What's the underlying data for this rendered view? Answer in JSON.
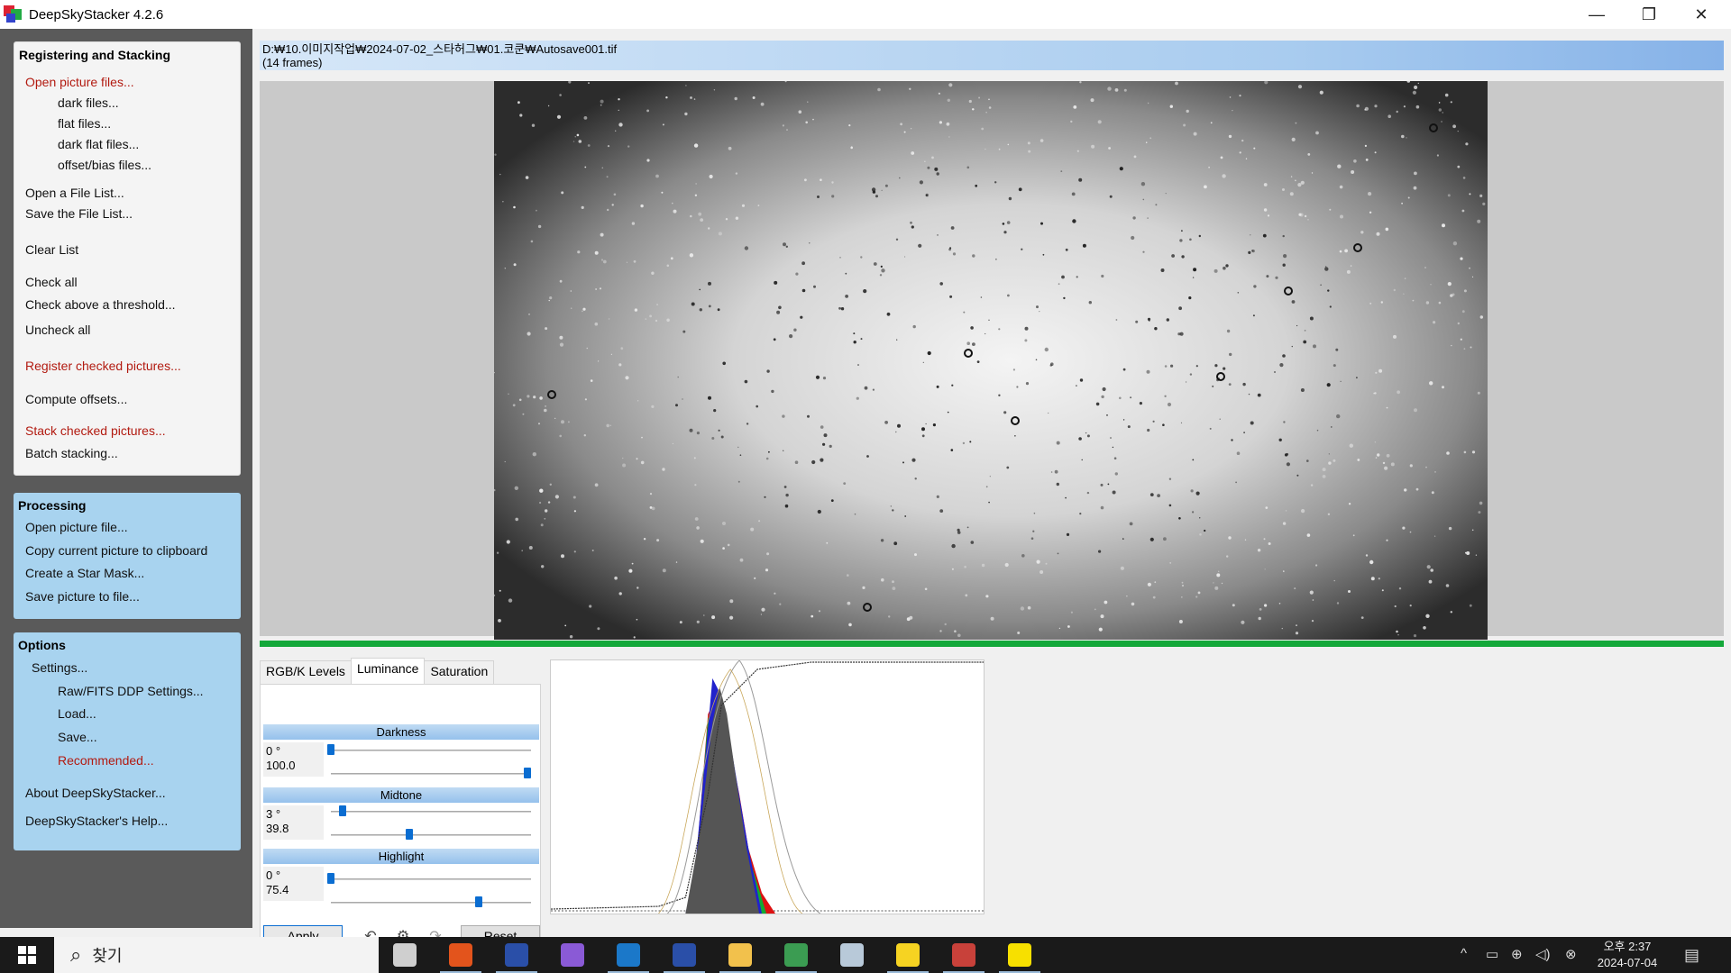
{
  "window": {
    "title": "DeepSkyStacker 4.2.6",
    "minimize_icon": "—",
    "restore_icon": "❐",
    "close_icon": "✕"
  },
  "groups": {
    "registering": {
      "title": "Registering and Stacking",
      "items": [
        {
          "label": "Open picture files...",
          "style": "red"
        },
        {
          "label": "dark files...",
          "style": "dark"
        },
        {
          "label": "flat files...",
          "style": "dark"
        },
        {
          "label": "dark flat files...",
          "style": "dark"
        },
        {
          "label": "offset/bias files...",
          "style": "dark"
        },
        {
          "label": "Open a File List...",
          "style": "dark"
        },
        {
          "label": "Save the File List...",
          "style": "dark"
        },
        {
          "label": "Clear List",
          "style": "dark"
        },
        {
          "label": "Check all",
          "style": "dark"
        },
        {
          "label": "Check above a threshold...",
          "style": "dark"
        },
        {
          "label": "Uncheck all",
          "style": "dark"
        },
        {
          "label": "Register checked pictures...",
          "style": "red"
        },
        {
          "label": "Compute offsets...",
          "style": "dark"
        },
        {
          "label": "Stack checked pictures...",
          "style": "red"
        },
        {
          "label": "Batch stacking...",
          "style": "dark"
        }
      ]
    },
    "processing": {
      "title": "Processing",
      "items": [
        {
          "label": "Open picture file..."
        },
        {
          "label": "Copy current picture to clipboard"
        },
        {
          "label": "Create a Star Mask..."
        },
        {
          "label": "Save picture to file..."
        }
      ]
    },
    "options": {
      "title": "Options",
      "items": [
        {
          "label": "Settings...",
          "style": "dark"
        },
        {
          "label": "Raw/FITS DDP Settings...",
          "style": "dark"
        },
        {
          "label": "Load...",
          "style": "dark"
        },
        {
          "label": "Save...",
          "style": "dark"
        },
        {
          "label": "Recommended...",
          "style": "red"
        },
        {
          "label": "About DeepSkyStacker...",
          "style": "dark"
        },
        {
          "label": "DeepSkyStacker's Help...",
          "style": "dark"
        }
      ]
    }
  },
  "file_info": {
    "path": "D:₩10.이미지작업₩2024-07-02_스타허그₩01.코쿤₩Autosave001.tif",
    "frames": "(14 frames)"
  },
  "tabs": [
    "RGB/K Levels",
    "Luminance",
    "Saturation"
  ],
  "active_tab": "Luminance",
  "luminance": {
    "darkness": {
      "label": "Darkness",
      "angle": "0 °",
      "value": "100.0",
      "angle_level": 0.0,
      "value_level": 1.0
    },
    "midtone": {
      "label": "Midtone",
      "angle": "3 °",
      "value": "39.8",
      "angle_level": 0.06,
      "value_level": 0.398
    },
    "highlight": {
      "label": "Highlight",
      "angle": "0 °",
      "value": "75.4",
      "angle_level": 0.0,
      "value_level": 0.754
    }
  },
  "buttons": {
    "apply": "Apply",
    "reset": "Reset",
    "undo_icon": "↶",
    "settings_icon": "⚙",
    "redo_icon": "↷"
  },
  "taskbar": {
    "search_label": "찾기",
    "search_icon": "⌕",
    "time": "오후 2:37",
    "date": "2024-07-04",
    "apps": [
      {
        "name": "task-view",
        "color": "#cfcfcf",
        "active": false
      },
      {
        "name": "app-orange",
        "color": "#e3541c",
        "active": true
      },
      {
        "name": "app-stellarium",
        "color": "#2a4fa8",
        "active": true
      },
      {
        "name": "visual-studio",
        "color": "#8a5ad6",
        "active": false
      },
      {
        "name": "intellij",
        "color": "#1b78c9",
        "active": true
      },
      {
        "name": "app-stellarium-2",
        "color": "#2a4fa8",
        "active": true
      },
      {
        "name": "file-explorer",
        "color": "#f2c14c",
        "active": true
      },
      {
        "name": "chrome",
        "color": "#3b9c52",
        "active": true
      },
      {
        "name": "paint",
        "color": "#b8c9d9",
        "active": false
      },
      {
        "name": "sticky-notes",
        "color": "#f6d322",
        "active": true
      },
      {
        "name": "deepskystacker",
        "color": "#c8413a",
        "active": true
      },
      {
        "name": "kakaotalk",
        "color": "#f7e000",
        "active": true
      }
    ],
    "tray": {
      "chevron_icon": "^",
      "battery_icon": "▭",
      "network_icon": "⊕",
      "volume_icon": "◁)",
      "close_circle_icon": "⊗",
      "notification_icon": "▤"
    }
  }
}
